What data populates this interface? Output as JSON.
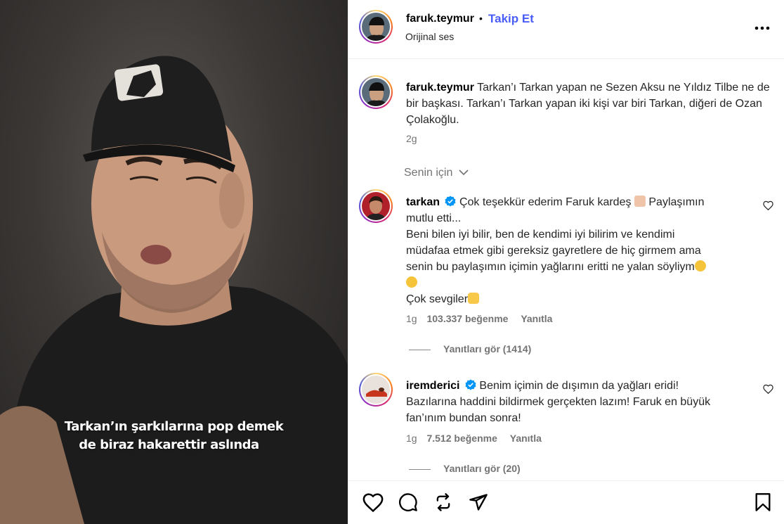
{
  "video": {
    "caption_line1": "Tarkan’ın şarkılarına pop demek",
    "caption_line2": "de biraz hakarettir aslında"
  },
  "header": {
    "username": "faruk.teymur",
    "separator": "•",
    "follow_label": "Takip Et",
    "audio": "Orijinal ses",
    "more_icon": "more-horizontal-icon"
  },
  "post": {
    "username": "faruk.teymur",
    "caption": "Tarkan’ı Tarkan yapan ne Sezen Aksu ne Yıldız Tilbe ne de bir başkası. Tarkan’ı Tarkan yapan iki kişi var biri Tarkan, diğeri de Ozan Çolakoğlu.",
    "time": "2g"
  },
  "filter": {
    "label": "Senin için"
  },
  "comments": [
    {
      "username": "tarkan",
      "verified": true,
      "line1": "Çok teşekkür ederim Faruk kardeş",
      "line1b": " Paylaşımın",
      "line2": "mutlu etti...",
      "line3": "Beni bilen iyi bilir, ben de kendimi iyi bilirim ve kendimi",
      "line4": "müdafaa etmek gibi gereksiz gayretlere de hiç girmem ama",
      "line5": "senin bu paylaşımın içimin yağlarını eritti ne yalan söyliym",
      "line7": "Çok sevgiler",
      "time": "1g",
      "likes": "103.337 beğenme",
      "reply": "Yanıtla",
      "view_replies": "Yanıtları gör (1414)"
    },
    {
      "username": "iremderici",
      "verified": true,
      "line1": "Benim içimin de dışımın da yağları eridi!",
      "line2": "Bazılarına haddini bildirmek gerçekten lazım! Faruk en büyük",
      "line3": "fan’ınım bundan sonra!",
      "time": "1g",
      "likes": "7.512 beğenme",
      "reply": "Yanıtla",
      "view_replies": "Yanıtları gör (20)"
    }
  ],
  "actions": {
    "like_icon": "heart-icon",
    "comment_icon": "comment-icon",
    "repost_icon": "repost-icon",
    "share_icon": "share-icon",
    "save_icon": "bookmark-icon"
  },
  "colors": {
    "follow": "#4a5df9",
    "verified": "#0095f6",
    "muted": "#737373"
  }
}
